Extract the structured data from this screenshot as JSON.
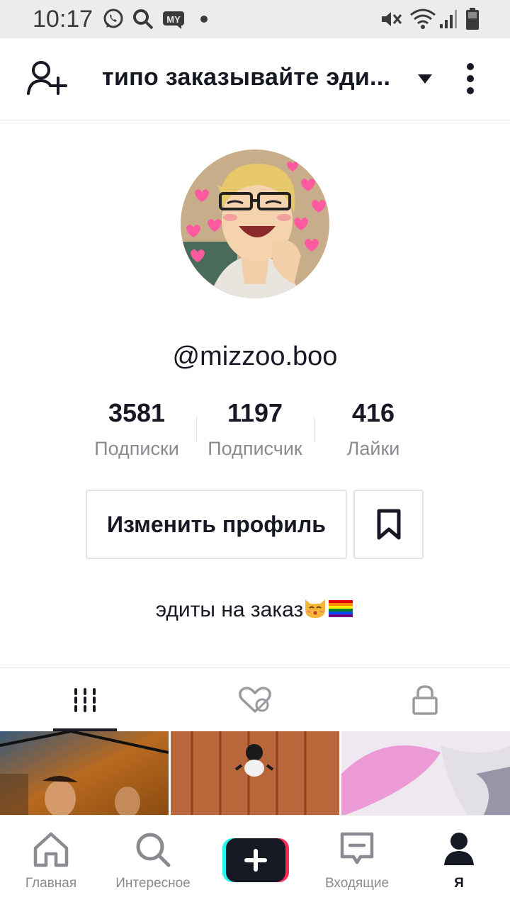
{
  "status_bar": {
    "time": "10:17"
  },
  "header": {
    "title": "типо заказывайте эди..."
  },
  "profile": {
    "username": "@mizzoo.boo",
    "stats": [
      {
        "value": "3581",
        "label": "Подписки"
      },
      {
        "value": "1197",
        "label": "Подписчик"
      },
      {
        "value": "416",
        "label": "Лайки"
      }
    ],
    "edit_button": "Изменить профиль",
    "bio": "эдиты на заказ"
  },
  "nav": {
    "items": [
      {
        "label": "Главная"
      },
      {
        "label": "Интересное"
      },
      {
        "label": "Входящие"
      },
      {
        "label": "Я"
      }
    ]
  },
  "colors": {
    "text": "#161823",
    "muted": "#8a8b91",
    "border": "#e3e3e4",
    "cyan": "#25f4ee",
    "red": "#fe2c55"
  }
}
